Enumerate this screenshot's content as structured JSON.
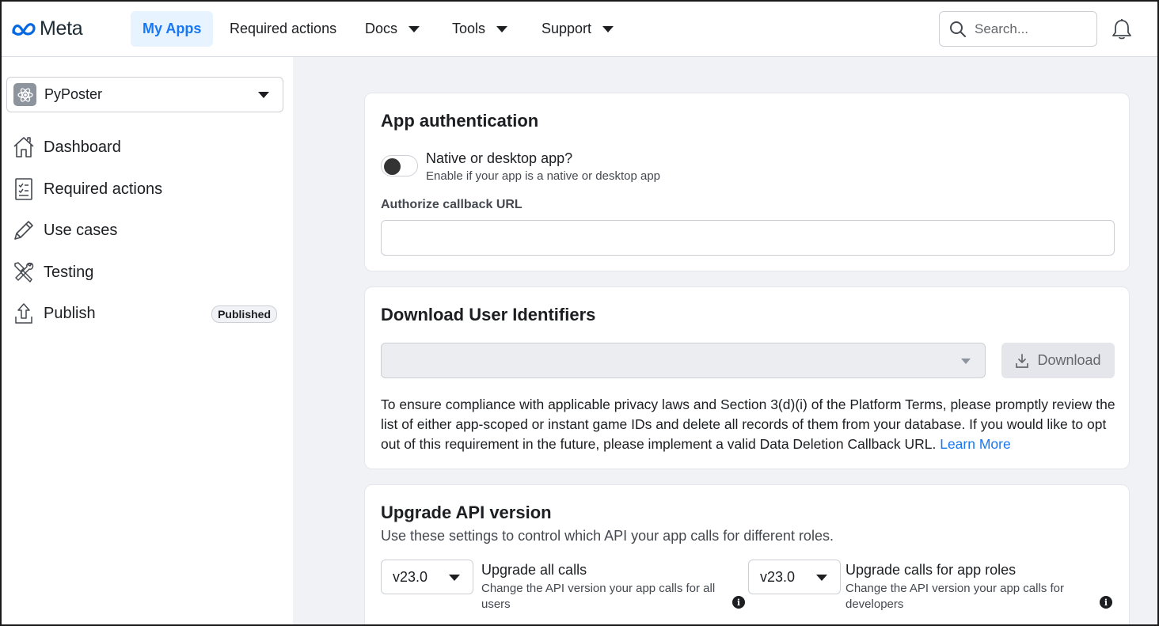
{
  "header": {
    "logo_text": "Meta",
    "nav": [
      {
        "label": "My Apps"
      },
      {
        "label": "Required actions"
      },
      {
        "label": "Docs"
      },
      {
        "label": "Tools"
      },
      {
        "label": "Support"
      }
    ],
    "search_placeholder": "Search..."
  },
  "sidebar": {
    "app_name": "PyPoster",
    "items": [
      {
        "label": "Dashboard",
        "icon": "house-icon"
      },
      {
        "label": "Required actions",
        "icon": "checklist-icon"
      },
      {
        "label": "Use cases",
        "icon": "pencil-icon"
      },
      {
        "label": "Testing",
        "icon": "tools-icon"
      },
      {
        "label": "Publish",
        "icon": "upload-icon",
        "badge": "Published"
      }
    ]
  },
  "auth": {
    "title": "App authentication",
    "toggle_title": "Native or desktop app?",
    "toggle_sub": "Enable if your app is a native or desktop app",
    "toggle_on": false,
    "callback_label": "Authorize callback URL",
    "callback_value": ""
  },
  "download": {
    "title": "Download User Identifiers",
    "button": "Download",
    "text": "To ensure compliance with applicable privacy laws and Section 3(d)(i) of the Platform Terms, please promptly review the list of either app-scoped or instant game IDs and delete all records of them from your database. If you would like to opt out of this requirement in the future, please implement a valid Data Deletion Callback URL.",
    "link": "Learn More"
  },
  "upgrade": {
    "title": "Upgrade API version",
    "subtitle": "Use these settings to control which API your app calls for different roles.",
    "all_calls": {
      "version": "v23.0",
      "title": "Upgrade all calls",
      "desc": "Change the API version your app calls for all users"
    },
    "role_calls": {
      "version": "v23.0",
      "title": "Upgrade calls for app roles",
      "desc": "Change the API version your app calls for developers"
    }
  },
  "colors": {
    "accent": "#1877f2",
    "active_nav_bg": "#e7f3ff",
    "page_bg": "#f0f2f5"
  }
}
